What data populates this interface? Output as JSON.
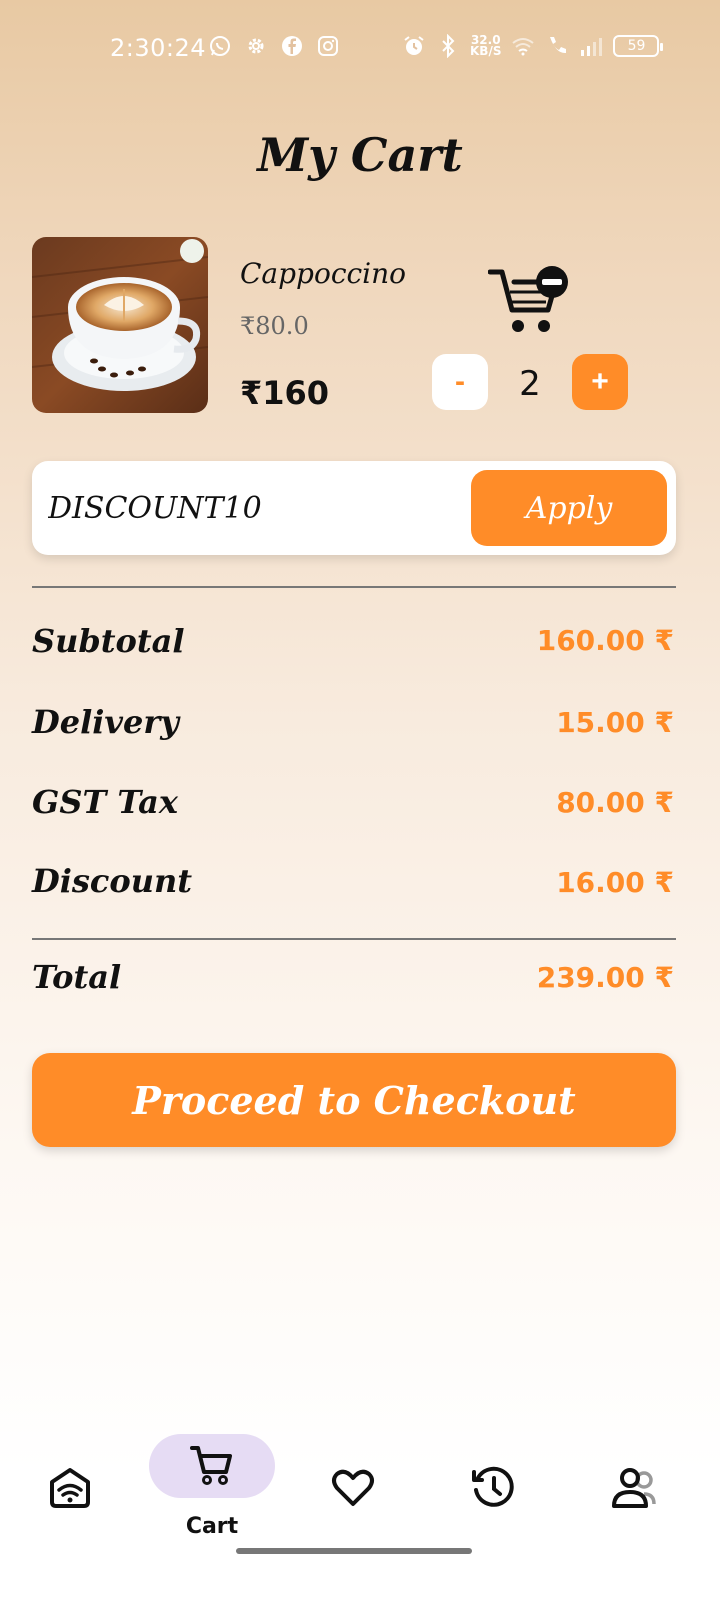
{
  "status_bar": {
    "time": "2:30:24",
    "net_speed_value": "32.0",
    "net_speed_unit": "KB/S",
    "battery": "59",
    "left_icons": [
      "whatsapp-icon",
      "settings-gear-icon",
      "facebook-icon",
      "instagram-icon"
    ],
    "right_icons": [
      "alarm-icon",
      "bluetooth-icon",
      "wifi-icon",
      "call-icon",
      "signal-icon"
    ]
  },
  "header": {
    "title": "My Cart"
  },
  "cart_item": {
    "name": "Cappoccino",
    "unit_price": "₹80.0",
    "total_price": "₹160",
    "quantity": "2",
    "minus_label": "-",
    "plus_label": "+",
    "image_alt": "Cappuccino in cup with latte art"
  },
  "discount": {
    "code": "DISCOUNT10",
    "apply_label": "Apply"
  },
  "summary": {
    "subtotal_label": "Subtotal",
    "subtotal_value": "160.00 ₹",
    "delivery_label": "Delivery",
    "delivery_value": "15.00 ₹",
    "gst_label": "GST Tax",
    "gst_value": "80.00 ₹",
    "discount_label": "Discount",
    "discount_value": "16.00 ₹",
    "total_label": "Total",
    "total_value": "239.00 ₹"
  },
  "checkout": {
    "label": "Proceed to Checkout"
  },
  "bottom_nav": {
    "items": [
      {
        "icon": "home-wifi-icon"
      },
      {
        "icon": "cart-icon",
        "label": "Cart",
        "active": true
      },
      {
        "icon": "heart-icon"
      },
      {
        "icon": "history-icon"
      },
      {
        "icon": "profile-icon"
      }
    ]
  },
  "colors": {
    "accent": "#ff8c28",
    "active_nav_bg": "#e6dcf4"
  }
}
